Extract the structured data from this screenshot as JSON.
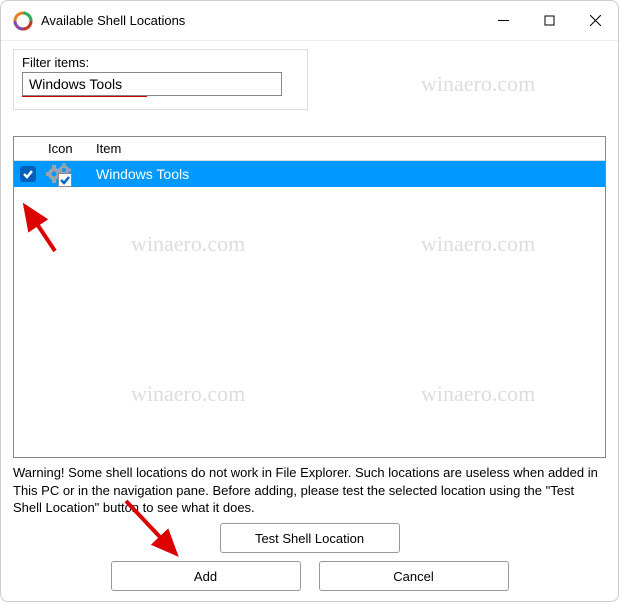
{
  "titlebar": {
    "title": "Available Shell Locations"
  },
  "filter": {
    "label": "Filter items:",
    "value": "Windows Tools"
  },
  "list": {
    "headers": {
      "icon": "Icon",
      "item": "Item"
    },
    "row": {
      "item": "Windows Tools"
    }
  },
  "warning": "Warning! Some shell locations do not work in File Explorer. Such locations are useless when added in This PC or in the navigation pane. Before adding, please test the selected location using the \"Test Shell Location\" button to see what it does.",
  "buttons": {
    "test": "Test Shell Location",
    "add": "Add",
    "cancel": "Cancel"
  },
  "watermark": "winaero.com"
}
